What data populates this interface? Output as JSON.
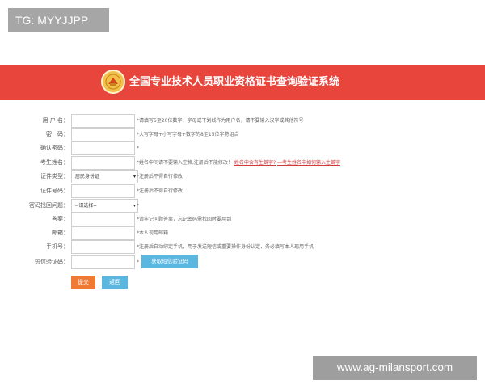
{
  "watermarks": {
    "top_left": "TG: MYYJJPP",
    "bottom_right": "www.ag-milansport.com"
  },
  "header": {
    "title": "全国专业技术人员职业资格证书查询验证系统",
    "logo_icon": "pta-emblem-icon",
    "bg_color": "#e8453c"
  },
  "form": {
    "rows": [
      {
        "label": "用 户 名：",
        "type": "input",
        "value": "",
        "hint": "*请填写5至20位数字、字母或下划线作为用户名，请不要输入汉字或其他符号"
      },
      {
        "label": "密　码：",
        "type": "password",
        "value": "",
        "hint": "*大写字母+小写字母+数字的8至15位字符组合"
      },
      {
        "label": "确认密码：",
        "type": "password",
        "value": "",
        "hint": "*"
      },
      {
        "label": "考生姓名：",
        "type": "input",
        "value": "",
        "hint": "*姓名中间请不要输入空格,注册后不能修改！",
        "hint_links": [
          "姓名中含有生僻字?",
          "—考生姓名中如何输入生僻字"
        ]
      },
      {
        "label": "证件类型：",
        "type": "select",
        "value": "居民身份证",
        "hint": "*注册后不得自行修改"
      },
      {
        "label": "证件号码：",
        "type": "input",
        "value": "",
        "hint": "*注册后不得自行修改"
      },
      {
        "label": "密码找回问题：",
        "type": "select",
        "value": "--请选择--",
        "hint": "*"
      },
      {
        "label": "答案：",
        "type": "input",
        "value": "",
        "hint": "*请牢记问题答案，忘记密码需找回时要用到"
      },
      {
        "label": "邮箱：",
        "type": "input",
        "value": "",
        "hint": "*本人现用邮箱"
      },
      {
        "label": "手机号：",
        "type": "input",
        "value": "",
        "hint": "*注册后自动绑定手机，用于发送短信或重要操作身份认定，务必填写本人现用手机"
      },
      {
        "label": "短信验证码：",
        "type": "input",
        "value": "",
        "hint": "*",
        "button": "获取短信验证码"
      }
    ],
    "submit_label": "提交",
    "back_label": "返回",
    "colors": {
      "submit": "#f07a33",
      "secondary": "#5bb6e0",
      "link": "#d23b3b"
    }
  }
}
